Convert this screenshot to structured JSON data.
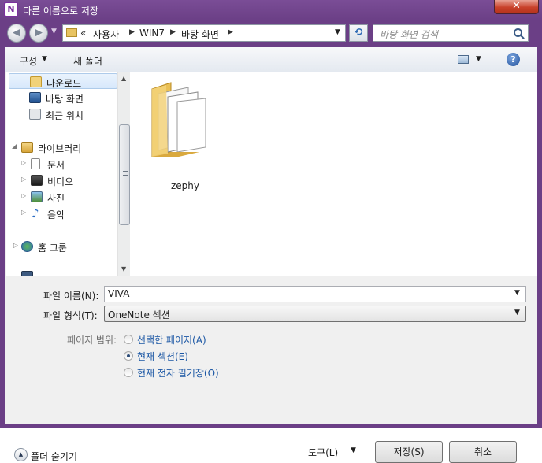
{
  "window": {
    "title": "다른 이름으로 저장",
    "close_glyph": "✕",
    "app_icon_letter": "N"
  },
  "address": {
    "back_glyph": "◀",
    "forward_glyph": "▶",
    "overflow": "«",
    "crumbs": [
      "사용자",
      "WIN7",
      "바탕 화면"
    ],
    "search_placeholder": "바탕 화면 검색"
  },
  "toolbar": {
    "organize": "구성",
    "new_folder": "새 폴더",
    "help": "?"
  },
  "nav": {
    "items": [
      {
        "label": "다운로드",
        "icon": "downloads-icon"
      },
      {
        "label": "바탕 화면",
        "icon": "desktop-icon"
      },
      {
        "label": "최근 위치",
        "icon": "recent-places-icon"
      },
      {
        "label": "라이브러리",
        "icon": "libraries-icon"
      },
      {
        "label": "문서",
        "icon": "documents-icon"
      },
      {
        "label": "비디오",
        "icon": "videos-icon"
      },
      {
        "label": "사진",
        "icon": "pictures-icon"
      },
      {
        "label": "음악",
        "icon": "music-icon"
      },
      {
        "label": "홈 그룹",
        "icon": "homegroup-icon"
      }
    ]
  },
  "files": [
    {
      "name": "zephy",
      "icon": "folder-icon"
    }
  ],
  "form": {
    "filename_label": "파일 이름(N):",
    "filename_value": "VIVA",
    "filetype_label": "파일 형식(T):",
    "filetype_value": "OneNote 섹션",
    "page_range_label": "페이지 범위:",
    "options": [
      {
        "label": "선택한 페이지(A)",
        "checked": false
      },
      {
        "label": "현재 섹션(E)",
        "checked": true
      },
      {
        "label": "현재 전자 필기장(O)",
        "checked": false
      }
    ]
  },
  "footer": {
    "hide_folders": "폴더 숨기기",
    "tools": "도구(L)",
    "save": "저장(S)",
    "cancel": "취소"
  },
  "colors": {
    "titlebar": "#6b3f86",
    "link_text": "#1a56a4"
  }
}
